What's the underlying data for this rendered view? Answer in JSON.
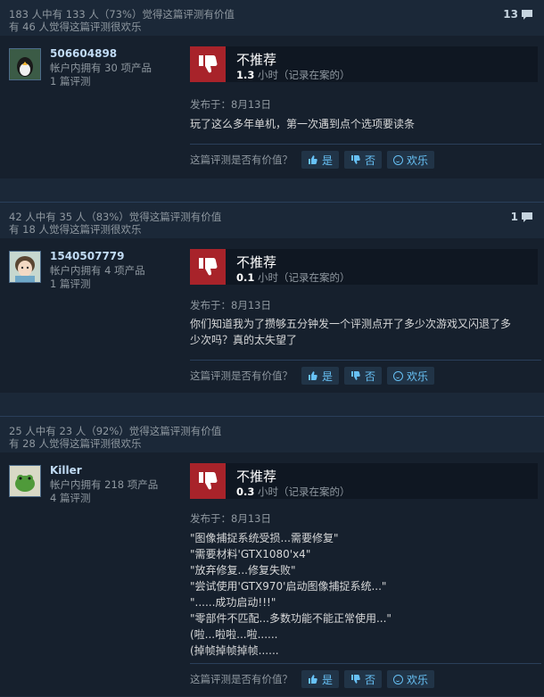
{
  "reviews": [
    {
      "helpful": "183 人中有 133 人（73%）觉得这篇评测有价值",
      "funny": "有 46 人觉得这篇评测很欢乐",
      "comments": "13",
      "user": {
        "name": "506604898",
        "products": "帐户内拥有 30 项产品",
        "reviews": "1 篇评测"
      },
      "verdict": "不推荐",
      "hours_value": "1.3",
      "hours_suffix": " 小时（记录在案的）",
      "posted": "发布于：8月13日",
      "text": "玩了这么多年单机，第一次遇到点个选项要读条"
    },
    {
      "helpful": "42 人中有 35 人（83%）觉得这篇评测有价值",
      "funny": "有 18 人觉得这篇评测很欢乐",
      "comments": "1",
      "user": {
        "name": "1540507779",
        "products": "帐户内拥有 4 项产品",
        "reviews": "1 篇评测"
      },
      "verdict": "不推荐",
      "hours_value": "0.1",
      "hours_suffix": " 小时（记录在案的）",
      "posted": "发布于：8月13日",
      "text": "你们知道我为了攒够五分钟发一个评测点开了多少次游戏又闪退了多\n少次吗？真的太失望了"
    },
    {
      "helpful": "25 人中有 23 人（92%）觉得这篇评测有价值",
      "funny": "有 28 人觉得这篇评测很欢乐",
      "comments": "",
      "user": {
        "name": "Killer",
        "products": "帐户内拥有 218 项产品",
        "reviews": "4 篇评测"
      },
      "verdict": "不推荐",
      "hours_value": "0.3",
      "hours_suffix": " 小时（记录在案的）",
      "posted": "发布于：8月13日",
      "text": "\"图像捕捉系统受损...需要修复\"\n\"需要材料'GTX1080'x4\"\n\"放弃修复...修复失败\"\n\"尝试使用'GTX970'启动图像捕捉系统...\"\n\"......成功启动!!!\"\n\"零部件不匹配...多数功能不能正常使用...\"\n(啦...啦啦...啦......\n(掉帧掉帧掉帧......"
    }
  ],
  "vote": {
    "question": "这篇评测是否有价值？",
    "yes": "是",
    "no": "否",
    "funny": "欢乐"
  },
  "icons": [
    "thumbs-down-icon",
    "thumbs-up-icon",
    "comment-icon",
    "smile-icon"
  ],
  "colors": {
    "background": "#1b2838",
    "panel": "#16202d",
    "not_recommended": "#a8232a",
    "link": "#67c1f5"
  }
}
